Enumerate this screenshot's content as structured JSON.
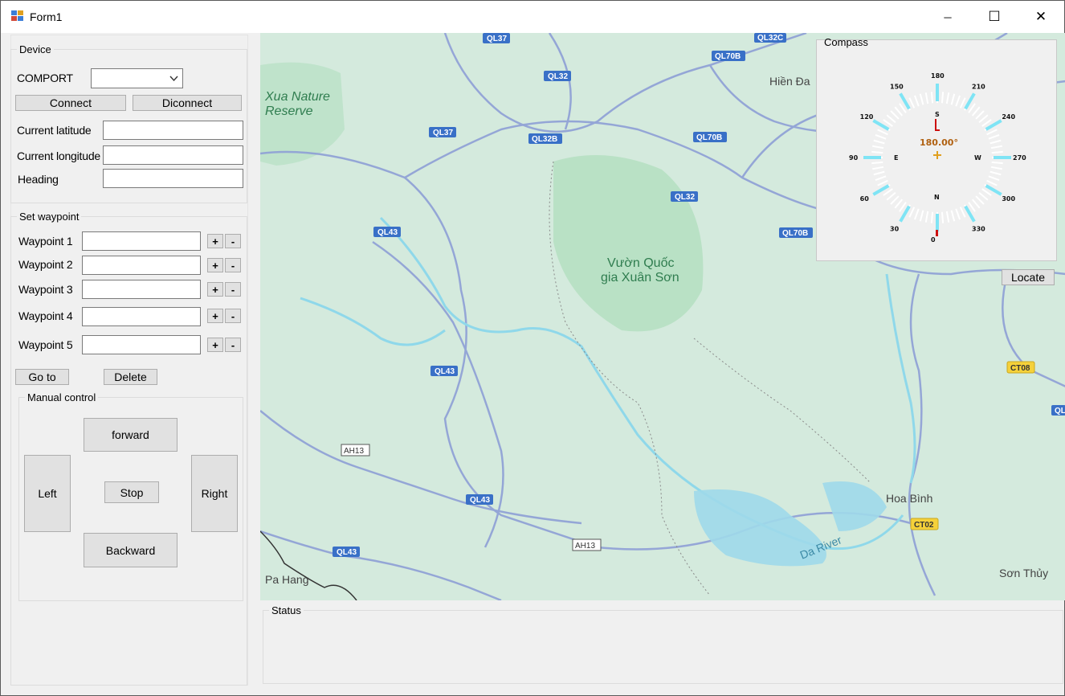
{
  "window": {
    "title": "Form1",
    "minimize_glyph": "─",
    "maximize_glyph": "☐",
    "close_glyph": "✕"
  },
  "device": {
    "group_label": "Device",
    "comport_label": "COMPORT",
    "comport_value": "",
    "connect_label": "Connect",
    "disconnect_label": "Diconnect",
    "latitude_label": "Current latitude",
    "latitude_value": "",
    "longitude_label": "Current longitude",
    "longitude_value": "",
    "heading_label": "Heading",
    "heading_value": ""
  },
  "waypoints": {
    "group_label": "Set waypoint",
    "items": [
      {
        "label": "Waypoint 1",
        "value": ""
      },
      {
        "label": "Waypoint 2",
        "value": ""
      },
      {
        "label": "Waypoint 3",
        "value": ""
      },
      {
        "label": "Waypoint 4",
        "value": ""
      },
      {
        "label": "Waypoint 5",
        "value": ""
      }
    ],
    "plus_label": "+",
    "minus_label": "-",
    "goto_label": "Go to",
    "delete_label": "Delete"
  },
  "manual": {
    "group_label": "Manual control",
    "forward_label": "forward",
    "left_label": "Left",
    "stop_label": "Stop",
    "right_label": "Right",
    "backward_label": "Backward"
  },
  "map": {
    "park_labels": [
      "Xua Nature",
      "Reserve",
      "Vườn Quốc",
      "gia Xuân Sơn"
    ],
    "places": [
      "Hiền Đa",
      "Hoa Bình",
      "Sơn Thủy",
      "Pa Hang"
    ],
    "river_label": "Da River",
    "shields": [
      "QL37",
      "QL32",
      "QL32C",
      "QL70B",
      "QL32B",
      "QL70B",
      "QL37",
      "QL32",
      "QL43",
      "QL70B",
      "QL43",
      "QL43",
      "QL43",
      "QL"
    ],
    "ah_shields": [
      "AH13",
      "AH13"
    ],
    "ct_shields": [
      "CT08",
      "CT02"
    ]
  },
  "compass": {
    "group_label": "Compass",
    "heading_readout": "180.00°",
    "dir_e": "E",
    "dir_w": "W",
    "dir_n": "N",
    "dir_s": "S",
    "degree_labels": [
      "180",
      "150",
      "210",
      "120",
      "240",
      "90",
      "270",
      "60",
      "300",
      "30",
      "330",
      "0"
    ],
    "accent_color": "#7fe4f5",
    "needle_color": "#cc1010",
    "center_color": "#e0a020",
    "locate_label": "Locate"
  },
  "status": {
    "group_label": "Status"
  }
}
